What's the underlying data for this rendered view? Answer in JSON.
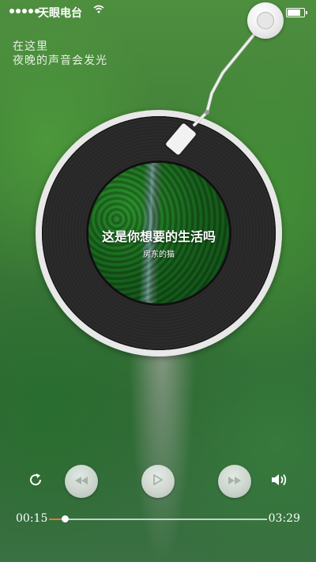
{
  "status_bar": {
    "carrier": "天眼电台",
    "signal_dots": 5
  },
  "lyrics": [
    "在这里",
    "夜晚的声音会发光"
  ],
  "song": {
    "title": "这是你想要的生活吗",
    "artist": "房东的猫"
  },
  "player": {
    "current_time": "00:15",
    "total_time": "03:29",
    "progress": 0.072,
    "played_color": "#e07a3c"
  },
  "icons": {
    "repeat": "repeat-icon",
    "rewind": "rewind-icon",
    "play": "play-icon",
    "fast_forward": "fast-forward-icon",
    "volume": "volume-icon"
  }
}
